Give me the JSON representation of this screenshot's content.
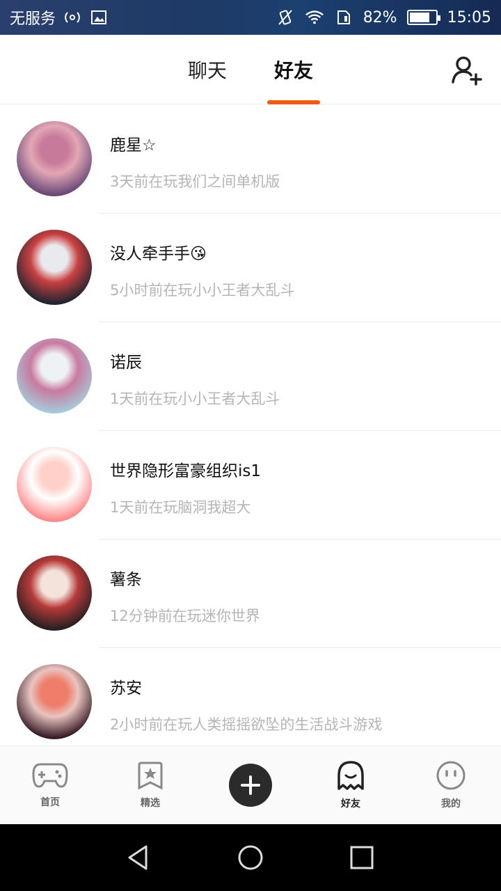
{
  "status_bar": {
    "carrier": "无服务",
    "battery": "82%",
    "battery_level": 0.82,
    "time": "15:05"
  },
  "header": {
    "tabs": [
      {
        "label": "聊天",
        "active": false
      },
      {
        "label": "好友",
        "active": true
      }
    ],
    "add_friend_icon": "add-user-icon"
  },
  "friends": [
    {
      "name": "鹿星☆",
      "status": "3天前在玩我们之间单机版",
      "avatar_colors": [
        "#6b4a78",
        "#c77a9a",
        "#e3a7b5"
      ]
    },
    {
      "name": "没人牵手手😘",
      "status": "5小时前在玩小小王者大乱斗",
      "avatar_colors": [
        "#222531",
        "#e9eaee",
        "#c94040"
      ]
    },
    {
      "name": "诺辰",
      "status": "1天前在玩小小王者大乱斗",
      "avatar_colors": [
        "#a7c8d8",
        "#eef2f4",
        "#c97aa0"
      ]
    },
    {
      "name": "世界隐形富豪组织is1",
      "status": "1天前在玩脑洞我超大",
      "avatar_colors": [
        "#ff8a8a",
        "#ffd0c8",
        "#ffffff"
      ]
    },
    {
      "name": "薯条",
      "status": "12分钟前在玩迷你世界",
      "avatar_colors": [
        "#2a2020",
        "#f3e3da",
        "#b73a3a"
      ]
    },
    {
      "name": "苏安",
      "status": "2小时前在玩人类摇摇欲坠的生活战斗游戏",
      "avatar_colors": [
        "#3a1f28",
        "#ef7d6a",
        "#e9c4c0"
      ]
    }
  ],
  "bottom_nav": {
    "items": [
      {
        "label": "首页",
        "icon": "gamepad-icon",
        "active": false
      },
      {
        "label": "精选",
        "icon": "star-bookmark-icon",
        "active": false
      },
      {
        "label": "",
        "icon": "plus-icon",
        "active": false
      },
      {
        "label": "好友",
        "icon": "ghost-icon",
        "active": true
      },
      {
        "label": "我的",
        "icon": "face-icon",
        "active": false
      }
    ]
  },
  "colors": {
    "accent": "#f05a14",
    "text_primary": "#111111",
    "text_secondary": "#b5b5b5"
  }
}
